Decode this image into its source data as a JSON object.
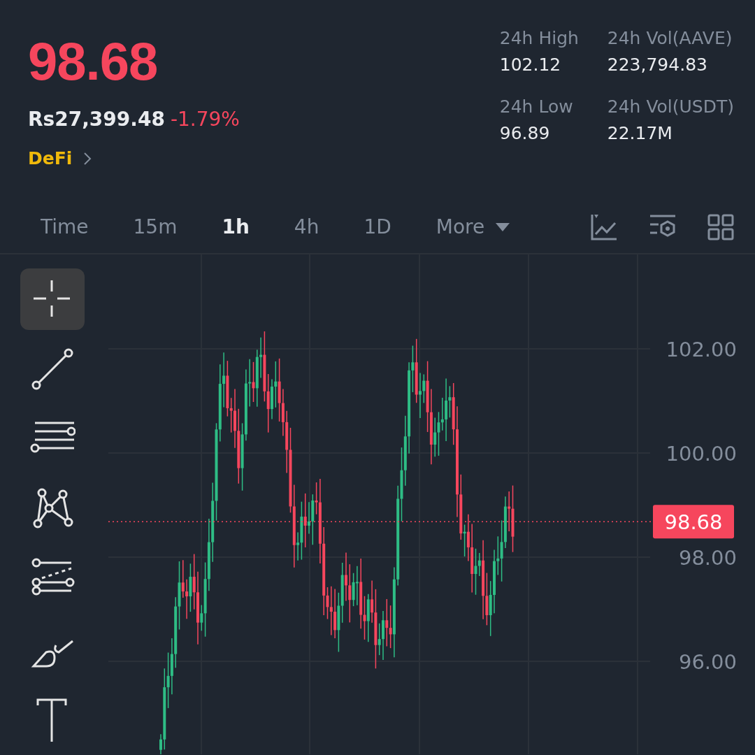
{
  "price": "98.68",
  "fiat_price": "Rs27,399.48",
  "change": "-1.79%",
  "category": "DeFi",
  "stats": [
    {
      "label": "24h High",
      "value": "102.12"
    },
    {
      "label": "24h Vol(AAVE)",
      "value": "223,794.83"
    },
    {
      "label": "24h Low",
      "value": "96.89"
    },
    {
      "label": "24h Vol(USDT)",
      "value": "22.17M"
    }
  ],
  "intervals": [
    {
      "label": "Time",
      "selected": false,
      "kind": "plain"
    },
    {
      "label": "15m",
      "selected": false,
      "kind": "plain"
    },
    {
      "label": "1h",
      "selected": true,
      "kind": "plain"
    },
    {
      "label": "4h",
      "selected": false,
      "kind": "plain"
    },
    {
      "label": "1D",
      "selected": false,
      "kind": "plain"
    },
    {
      "label": "More",
      "selected": false,
      "kind": "dropdown"
    }
  ],
  "tools": [
    {
      "kind": "crosshair",
      "selected": true
    },
    {
      "kind": "trendline",
      "selected": false
    },
    {
      "kind": "parallel",
      "selected": false
    },
    {
      "kind": "pattern",
      "selected": false
    },
    {
      "kind": "fib",
      "selected": false
    },
    {
      "kind": "brush",
      "selected": false
    },
    {
      "kind": "text",
      "selected": false
    }
  ],
  "chart": {
    "y_labels": [
      "102.00",
      "100.00",
      "98.00",
      "96.00"
    ],
    "last_price": "98.68"
  }
}
